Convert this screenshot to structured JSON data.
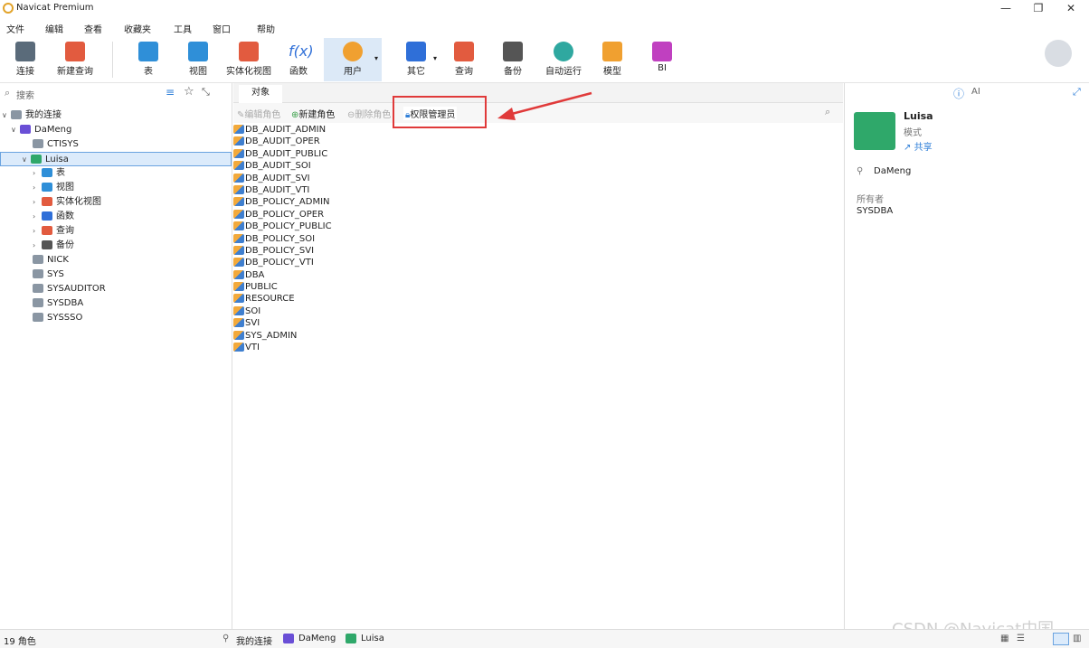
{
  "window": {
    "title": "Navicat Premium"
  },
  "menu": [
    "文件",
    "编辑",
    "查看",
    "收藏夹",
    "工具",
    "窗口",
    "帮助"
  ],
  "toolbar": {
    "items": [
      {
        "label": "连接",
        "icon": "plug-icon",
        "color": "#5a6b7a"
      },
      {
        "label": "新建查询",
        "icon": "new-query-icon",
        "color": "#e25b3f"
      },
      {
        "label": "表",
        "icon": "table-icon",
        "color": "#2f8fd8"
      },
      {
        "label": "视图",
        "icon": "view-icon",
        "color": "#2f8fd8"
      },
      {
        "label": "实体化视图",
        "icon": "materialized-view-icon",
        "color": "#e25b3f"
      },
      {
        "label": "函数",
        "icon": "function-icon",
        "color": "#2f6fd8"
      },
      {
        "label": "用户",
        "icon": "user-icon",
        "color": "#f0a030"
      },
      {
        "label": "其它",
        "icon": "tools-icon",
        "color": "#2f6fd8"
      },
      {
        "label": "查询",
        "icon": "query-icon",
        "color": "#e25b3f"
      },
      {
        "label": "备份",
        "icon": "backup-icon",
        "color": "#555555"
      },
      {
        "label": "自动运行",
        "icon": "robot-icon",
        "color": "#2fa8a0"
      },
      {
        "label": "模型",
        "icon": "model-icon",
        "color": "#f0a030"
      },
      {
        "label": "BI",
        "icon": "bi-icon",
        "color": "#c040c0"
      }
    ]
  },
  "sidebar": {
    "search_placeholder": "搜索",
    "tree": {
      "root": "我的连接",
      "connection": "DaMeng",
      "schemas_before": [
        "CTISYS"
      ],
      "selected": "Luisa",
      "children": [
        "表",
        "视图",
        "实体化视图",
        "函数",
        "查询",
        "备份"
      ],
      "schemas_after": [
        "NICK",
        "SYS",
        "SYSAUDITOR",
        "SYSDBA",
        "SYSSSO"
      ]
    }
  },
  "center": {
    "tab": "对象",
    "toolbar": {
      "edit_role": "编辑角色",
      "new_role": "新建角色",
      "delete_role": "删除角色",
      "privilege_manager": "权限管理员"
    },
    "roles": [
      "DB_AUDIT_ADMIN",
      "DB_AUDIT_OPER",
      "DB_AUDIT_PUBLIC",
      "DB_AUDIT_SOI",
      "DB_AUDIT_SVI",
      "DB_AUDIT_VTI",
      "DB_POLICY_ADMIN",
      "DB_POLICY_OPER",
      "DB_POLICY_PUBLIC",
      "DB_POLICY_SOI",
      "DB_POLICY_SVI",
      "DB_POLICY_VTI",
      "DBA",
      "PUBLIC",
      "RESOURCE",
      "SOI",
      "SVI",
      "SYS_ADMIN",
      "VTI"
    ]
  },
  "info_panel": {
    "ai_label": "AI",
    "name": "Luisa",
    "type": "模式",
    "share": "共享",
    "connection": "DaMeng",
    "owner_label": "所有者",
    "owner_value": "SYSDBA"
  },
  "status": {
    "count": "19 角色",
    "crumbs": [
      "我的连接",
      "DaMeng",
      "Luisa"
    ]
  },
  "watermark": "CSDN @Navicat中国",
  "colors": {
    "accent": "#2f7fd8",
    "highlight": "#e03a3a",
    "selection": "#dcebfb"
  }
}
